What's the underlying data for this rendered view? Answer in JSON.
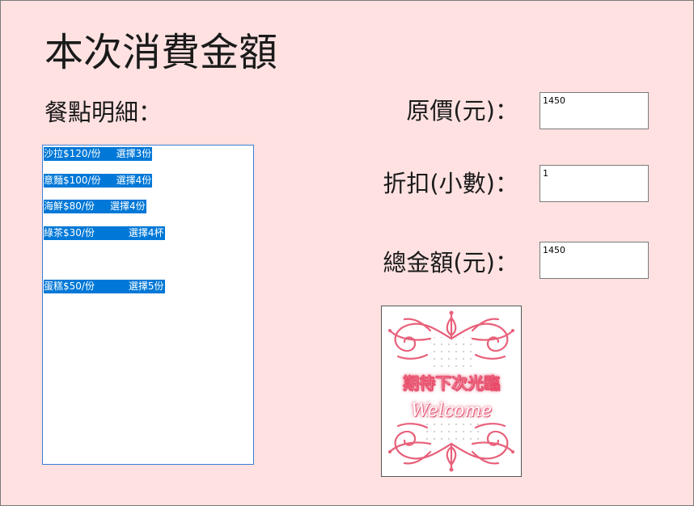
{
  "form": {
    "title": "本次消費金額",
    "detail_label": "餐點明細："
  },
  "order_list": {
    "items": [
      "沙拉$120/份     選擇3份",
      "意麵$100/份     選擇4份",
      "海鮮$80/份     選擇4份",
      "綠茶$30/份           選擇4杯",
      "蛋糕$50/份           選擇5份"
    ]
  },
  "fields": {
    "original_price": {
      "label": "原價(元)：",
      "value": "1450"
    },
    "discount": {
      "label": "折扣(小數)：",
      "value": "1"
    },
    "total": {
      "label": "總金額(元)：",
      "value": "1450"
    }
  },
  "picture": {
    "text_cn": "期待下次光臨",
    "text_en": "Welcome"
  },
  "colors": {
    "form_background": "#ffe1e1",
    "selection": "#0078d7",
    "decoration": "#e8607a"
  }
}
